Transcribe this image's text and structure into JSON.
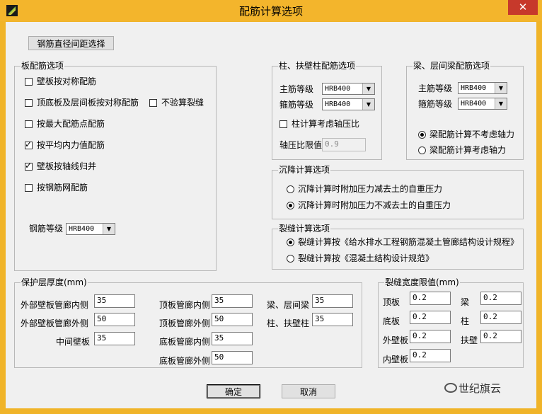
{
  "window": {
    "title": "配筋计算选项",
    "close": "✕"
  },
  "top_button": "钢筋直径间距选择",
  "wall_group": {
    "label": "板配筋选项",
    "items": [
      {
        "label": "壁板按对称配筋",
        "checked": false
      },
      {
        "label": "顶底板及层间板按对称配筋",
        "checked": false
      },
      {
        "label": "不验算裂缝",
        "checked": false
      },
      {
        "label": "按最大配筋点配筋",
        "checked": false
      },
      {
        "label": "按平均内力值配筋",
        "checked": true
      },
      {
        "label": "壁板按轴线归并",
        "checked": true
      },
      {
        "label": "按钢筋网配筋",
        "checked": false
      }
    ],
    "grade_label": "钢筋等级",
    "grade_value": "HRB400"
  },
  "column_group": {
    "label": "柱、扶壁柱配筋选项",
    "main_label": "主筋等级",
    "main_value": "HRB400",
    "stirrup_label": "箍筋等级",
    "stirrup_value": "HRB400",
    "axial_label": "柱计算考虑轴压比",
    "axial_checked": false,
    "ratio_label": "轴压比限值",
    "ratio_value": "0.9"
  },
  "beam_group": {
    "label": "梁、层间梁配筋选项",
    "main_label": "主筋等级",
    "main_value": "HRB400",
    "stirrup_label": "箍筋等级",
    "stirrup_value": "HRB400",
    "radio1": "梁配筋计算不考虑轴力",
    "radio2": "梁配筋计算考虑轴力",
    "selected": 1
  },
  "settle_group": {
    "label": "沉降计算选项",
    "radio1": "沉降计算时附加压力减去土的自重压力",
    "radio2": "沉降计算时附加压力不减去土的自重压力",
    "selected": 2
  },
  "crack_group": {
    "label": "裂缝计算选项",
    "radio1": "裂缝计算按《给水排水工程钢筋混凝土管廊结构设计规程》",
    "radio2": "裂缝计算按《混凝土结构设计规范》",
    "selected": 1
  },
  "cover_group": {
    "label": "保护层厚度(mm)",
    "outer_in_label": "外部壁板管廊内侧",
    "outer_in": "35",
    "outer_out_label": "外部壁板管廊外侧",
    "outer_out": "50",
    "middle_label": "中间壁板",
    "middle": "35",
    "top_in_label": "顶板管廊内侧",
    "top_in": "35",
    "top_out_label": "顶板管廊外侧",
    "top_out": "50",
    "bot_in_label": "底板管廊内侧",
    "bot_in": "35",
    "bot_out_label": "底板管廊外侧",
    "bot_out": "50",
    "beam_label": "梁、层间梁",
    "beam": "35",
    "col_label": "柱、扶壁柱",
    "col": "35"
  },
  "crackw_group": {
    "label": "裂缝宽度限值(mm)",
    "top_label": "顶板",
    "top": "0.2",
    "bottom_label": "底板",
    "bottom": "0.2",
    "outer_label": "外壁板",
    "outer": "0.2",
    "inner_label": "内壁板",
    "inner": "0.2",
    "beam_label": "梁",
    "beam": "0.2",
    "col_label": "柱",
    "col": "0.2",
    "butt_label": "扶壁",
    "butt": "0.2"
  },
  "ok": "确定",
  "cancel": "取消",
  "watermark": "世纪旗云"
}
